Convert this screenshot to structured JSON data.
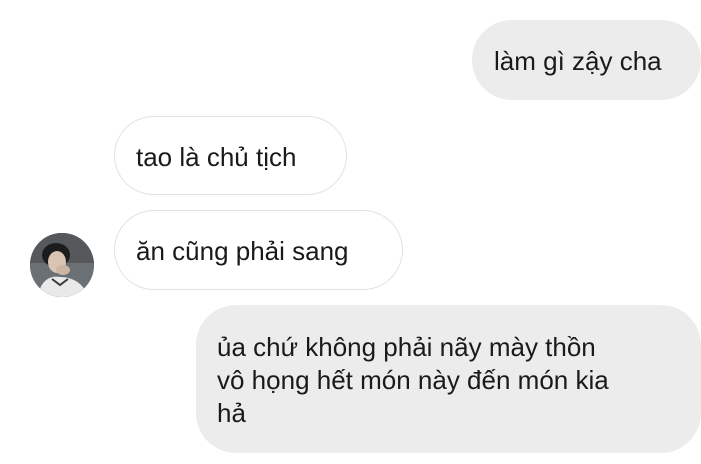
{
  "conversation": {
    "messages": [
      {
        "sender": "self",
        "text": "làm gì zậy cha"
      },
      {
        "sender": "other",
        "text": "tao là chủ tịch"
      },
      {
        "sender": "other",
        "text": "ăn cũng phải sang"
      },
      {
        "sender": "self",
        "text": "ủa chứ không phải nãy mày thồn\nvô họng hết món này đến món kia\nhả"
      }
    ],
    "avatar_icon": "user-photo-avatar"
  },
  "colors": {
    "outgoing_bubble": "#ececec",
    "incoming_bubble": "#ffffff",
    "incoming_border": "#e2e2e2",
    "text": "#1a1a1a"
  }
}
